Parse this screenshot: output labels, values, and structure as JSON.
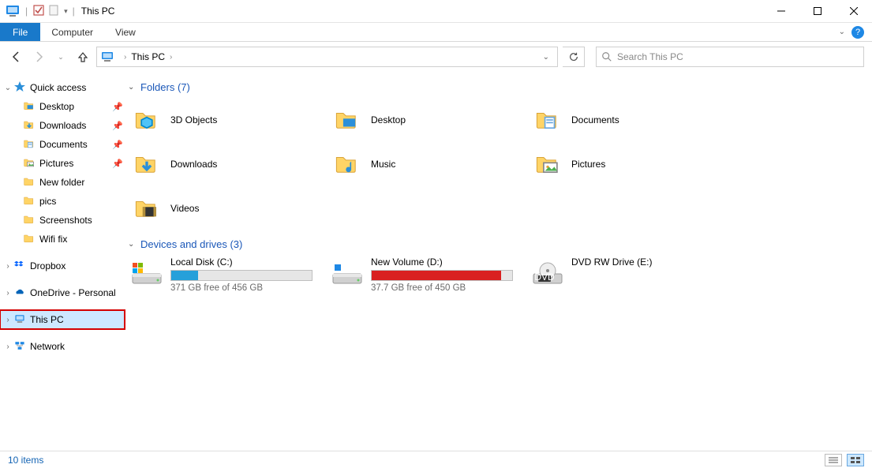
{
  "window": {
    "title": "This PC"
  },
  "ribbon": {
    "file": "File",
    "tabs": [
      "Computer",
      "View"
    ]
  },
  "address": {
    "location": "This PC"
  },
  "search": {
    "placeholder": "Search This PC"
  },
  "sidebar": {
    "quick_access": {
      "label": "Quick access"
    },
    "quick_items": [
      {
        "label": "Desktop",
        "pinned": true,
        "icon": "desktop"
      },
      {
        "label": "Downloads",
        "pinned": true,
        "icon": "downloads"
      },
      {
        "label": "Documents",
        "pinned": true,
        "icon": "documents"
      },
      {
        "label": "Pictures",
        "pinned": true,
        "icon": "pictures"
      },
      {
        "label": "New folder",
        "pinned": false,
        "icon": "folder"
      },
      {
        "label": "pics",
        "pinned": false,
        "icon": "folder"
      },
      {
        "label": "Screenshots",
        "pinned": false,
        "icon": "folder"
      },
      {
        "label": "Wifi fix",
        "pinned": false,
        "icon": "folder"
      }
    ],
    "roots": [
      {
        "label": "Dropbox",
        "icon": "dropbox"
      },
      {
        "label": "OneDrive - Personal",
        "icon": "onedrive"
      },
      {
        "label": "This PC",
        "icon": "thispc",
        "selected": true
      },
      {
        "label": "Network",
        "icon": "network"
      }
    ]
  },
  "folders_group": {
    "label": "Folders (7)"
  },
  "folders": [
    {
      "label": "3D Objects",
      "icon": "3d"
    },
    {
      "label": "Desktop",
      "icon": "desktop"
    },
    {
      "label": "Documents",
      "icon": "documents"
    },
    {
      "label": "Downloads",
      "icon": "downloads"
    },
    {
      "label": "Music",
      "icon": "music"
    },
    {
      "label": "Pictures",
      "icon": "pictures"
    },
    {
      "label": "Videos",
      "icon": "videos"
    }
  ],
  "drives_group": {
    "label": "Devices and drives (3)"
  },
  "drives": [
    {
      "label": "Local Disk (C:)",
      "free": "371 GB free of 456 GB",
      "fill_pct": 19,
      "fill_color": "#26a0da"
    },
    {
      "label": "New Volume (D:)",
      "free": "37.7 GB free of 450 GB",
      "fill_pct": 92,
      "fill_color": "#d92020"
    },
    {
      "label": "DVD RW Drive (E:)",
      "free": "",
      "fill_pct": 0,
      "fill_color": ""
    }
  ],
  "status": {
    "text": "10 items"
  }
}
